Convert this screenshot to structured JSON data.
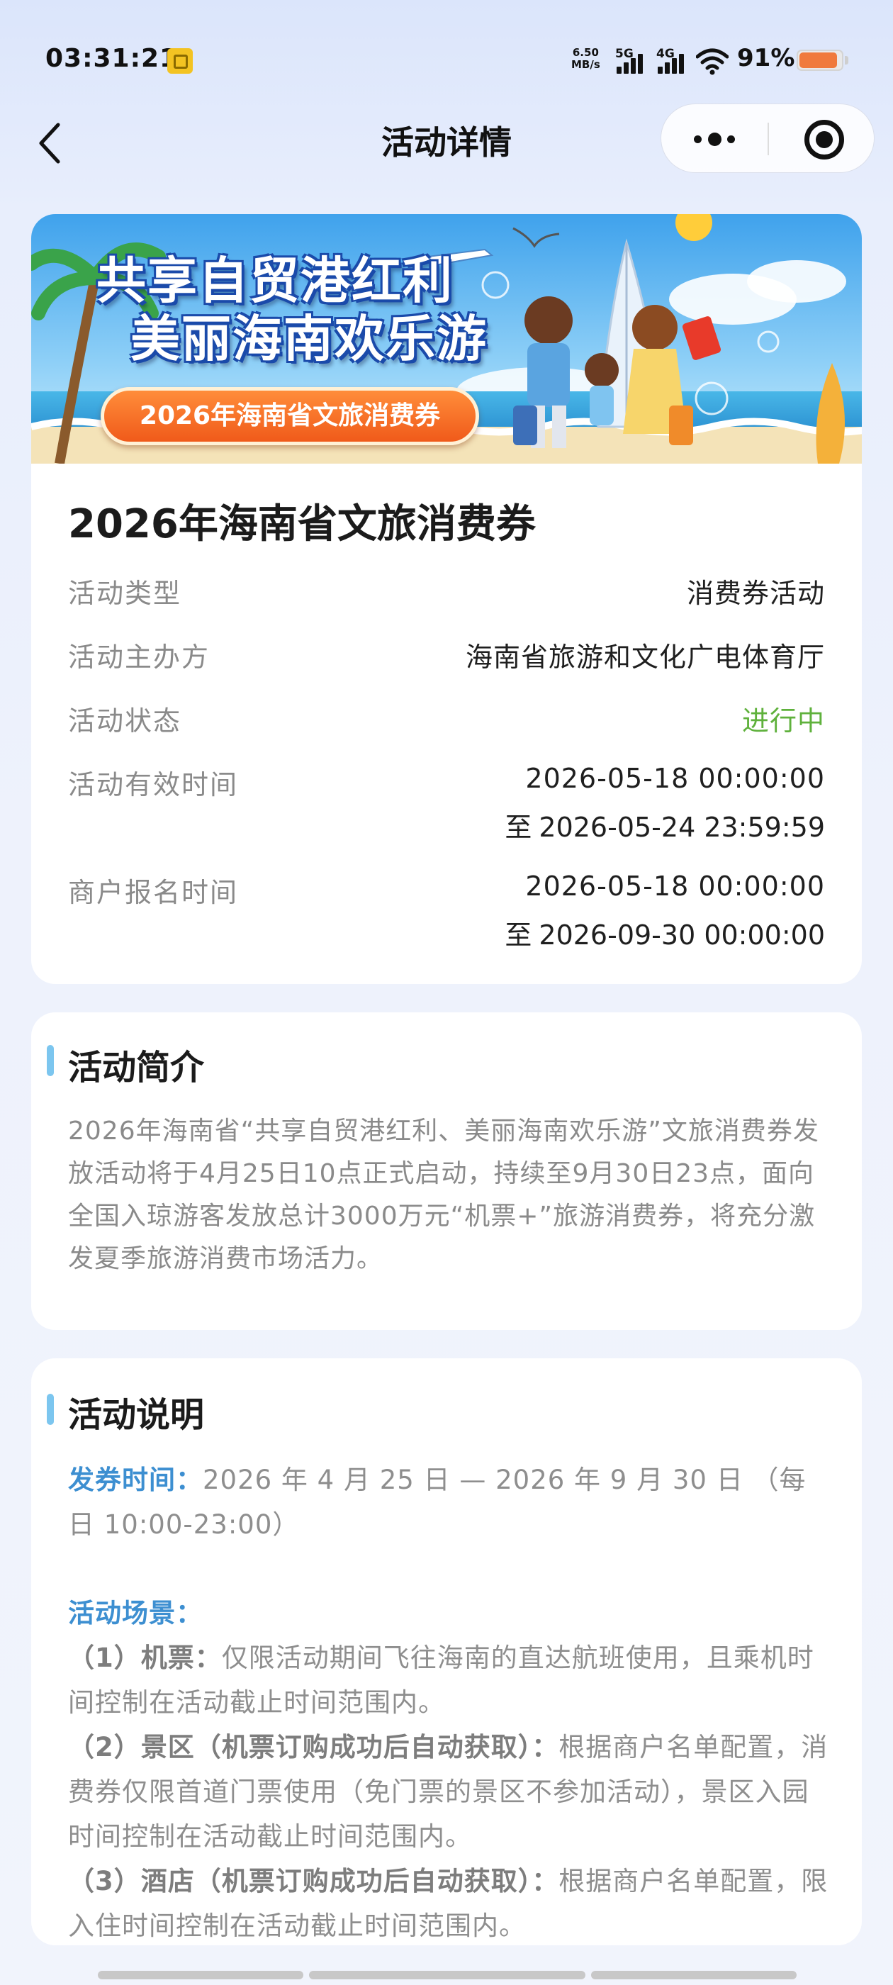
{
  "status_bar": {
    "time": "03:31:21",
    "net_speed_value": "6.50",
    "net_speed_unit": "MB/s",
    "signal_1": "5G",
    "signal_2": "4G",
    "battery_percent": "91%",
    "battery_level": 0.91,
    "battery_color": "#f07a3c"
  },
  "nav": {
    "title": "活动详情",
    "back_icon": "chevron-left-icon",
    "more_icon": "more-dots-icon",
    "close_icon": "target-close-icon"
  },
  "banner": {
    "line1": "共享自贸港红利",
    "line2": "美丽海南欢乐游",
    "pill": "2026年海南省文旅消费券"
  },
  "activity": {
    "name": "2026年海南省文旅消费券",
    "rows": [
      {
        "label": "活动类型",
        "value": "消费券活动"
      },
      {
        "label": "活动主办方",
        "value": "海南省旅游和文化广电体育厅"
      },
      {
        "label": "活动状态",
        "value": "进行中"
      },
      {
        "label": "活动有效时间",
        "value": "2026-05-18 00:00:00",
        "to_prefix": "至",
        "value2": "2026-05-24 23:59:59"
      },
      {
        "label": "商户报名时间",
        "value": "2026-05-18 00:00:00",
        "to_prefix": "至",
        "value2": "2026-09-30 00:00:00"
      }
    ],
    "status_color": "#5fb13c"
  },
  "intro": {
    "heading": "活动简介",
    "text": "2026年海南省“共享自贸港红利、美丽海南欢乐游”文旅消费券发放活动将于4月25日10点正式启动，持续至9月30日23点，面向全国入琼游客发放总计3000万元“机票+”旅游消费券，将充分激发夏季旅游消费市场活力。"
  },
  "description": {
    "heading": "活动说明",
    "issue_label": "发券时间：",
    "issue_text": "2026 年 4 月 25 日 — 2026 年 9 月 30 日 （每日 10:00-23:00）",
    "scene_label": "活动场景：",
    "item1_head": "（1）机票：",
    "item1_text": "仅限活动期间飞往海南的直达航班使用，且乘机时间控制在活动截止时间范围内。",
    "item2_head": "（2）景区（机票订购成功后自动获取）：",
    "item2_text": "根据商户名单配置，消费券仅限首道门票使用（免门票的景区不参加活动），景区入园时间控制在活动截止时间范围内。",
    "item3_head": "（3）酒店（机票订购成功后自动获取）：",
    "item3_text": "根据商户名单配置，限入住时间控制在活动截止时间范围内。"
  },
  "accent_color": "#7cc6ef",
  "label_blue": "#3d8fd1"
}
